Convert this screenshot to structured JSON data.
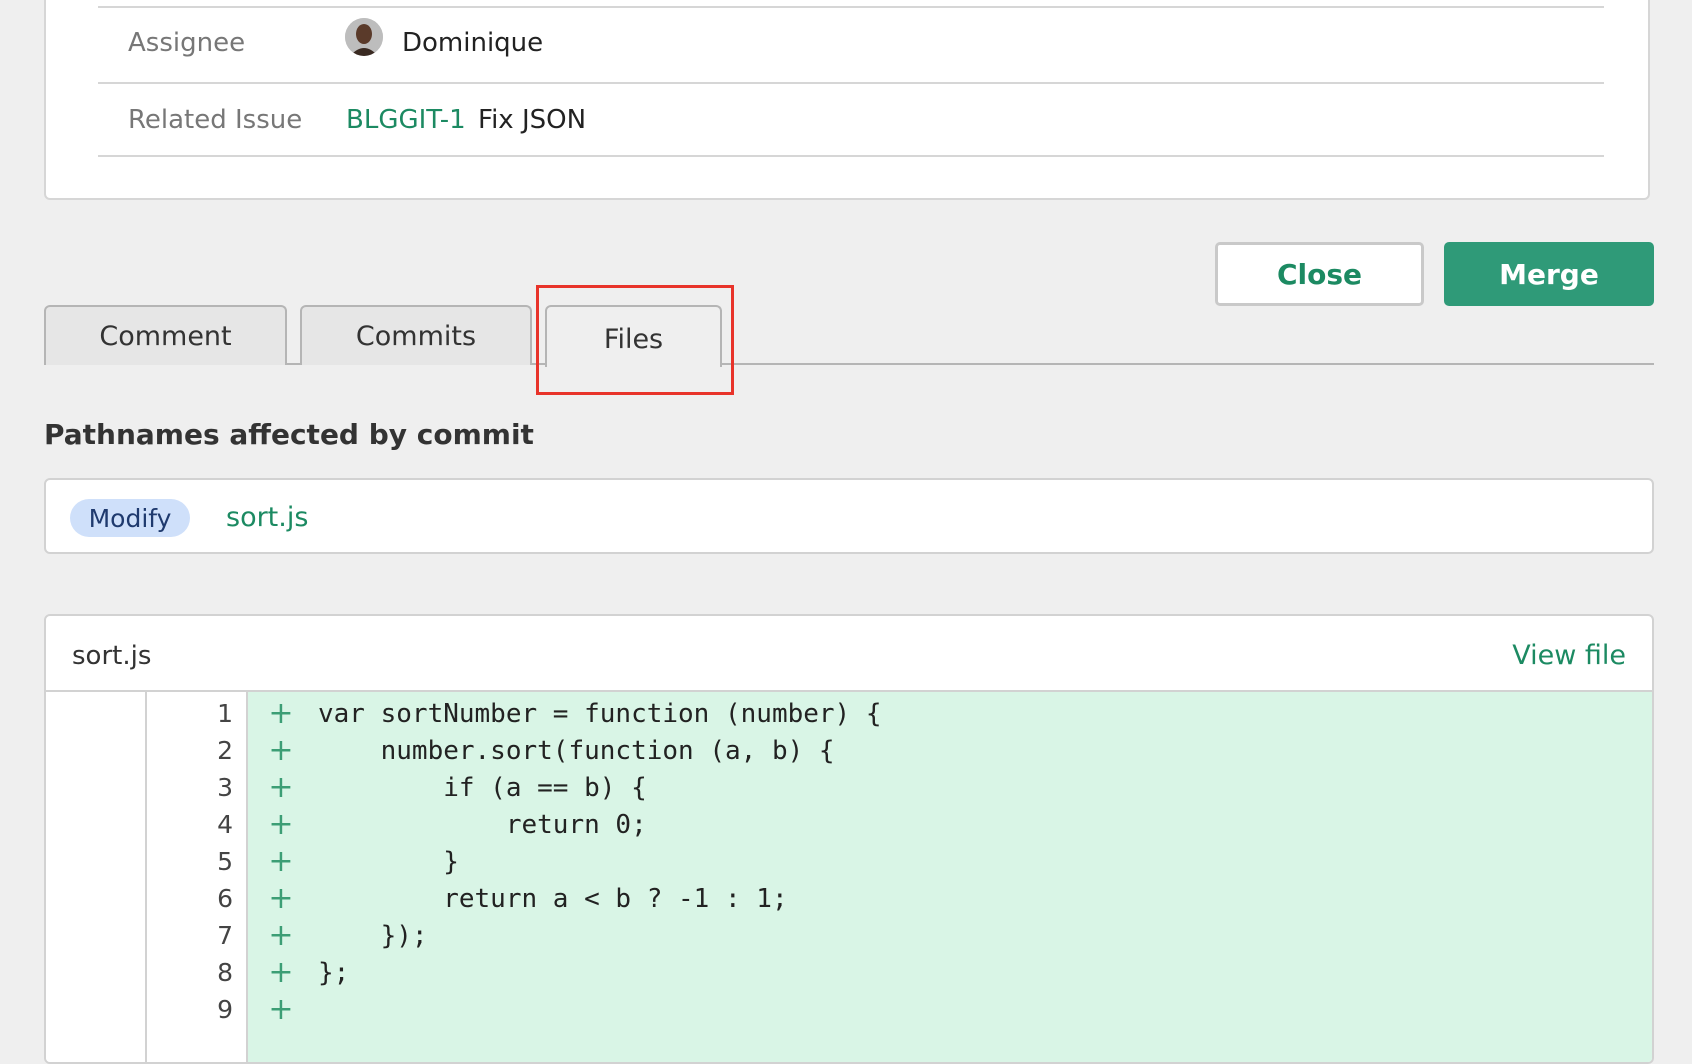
{
  "details": {
    "assignee_label": "Assignee",
    "assignee_name": "Dominique",
    "related_label": "Related Issue",
    "issue_key": "BLGGIT-1",
    "issue_title": "Fix JSON"
  },
  "actions": {
    "close_label": "Close",
    "merge_label": "Merge"
  },
  "tabs": [
    {
      "label": "Comment",
      "active": false
    },
    {
      "label": "Commits",
      "active": false
    },
    {
      "label": "Files",
      "active": true
    }
  ],
  "pathnames": {
    "title": "Pathnames affected by commit",
    "items": [
      {
        "badge": "Modify",
        "path": "sort.js"
      }
    ]
  },
  "diff": {
    "file_name": "sort.js",
    "view_file_label": "View file",
    "lines": [
      {
        "num": "1",
        "marker": "+",
        "code": "var sortNumber = function (number) {"
      },
      {
        "num": "2",
        "marker": "+",
        "code": "    number.sort(function (a, b) {"
      },
      {
        "num": "3",
        "marker": "+",
        "code": "        if (a == b) {"
      },
      {
        "num": "4",
        "marker": "+",
        "code": "            return 0;"
      },
      {
        "num": "5",
        "marker": "+",
        "code": "        }"
      },
      {
        "num": "6",
        "marker": "+",
        "code": "        return a < b ? -1 : 1;"
      },
      {
        "num": "7",
        "marker": "+",
        "code": "    });"
      },
      {
        "num": "8",
        "marker": "+",
        "code": "};"
      },
      {
        "num": "9",
        "marker": "+",
        "code": ""
      }
    ]
  },
  "colors": {
    "accent_green": "#1c8a62",
    "merge_button": "#2f9a78",
    "added_line_bg": "#d9f5e6",
    "highlight_box": "#e8332a",
    "modify_badge_bg": "#cfe0fa"
  }
}
